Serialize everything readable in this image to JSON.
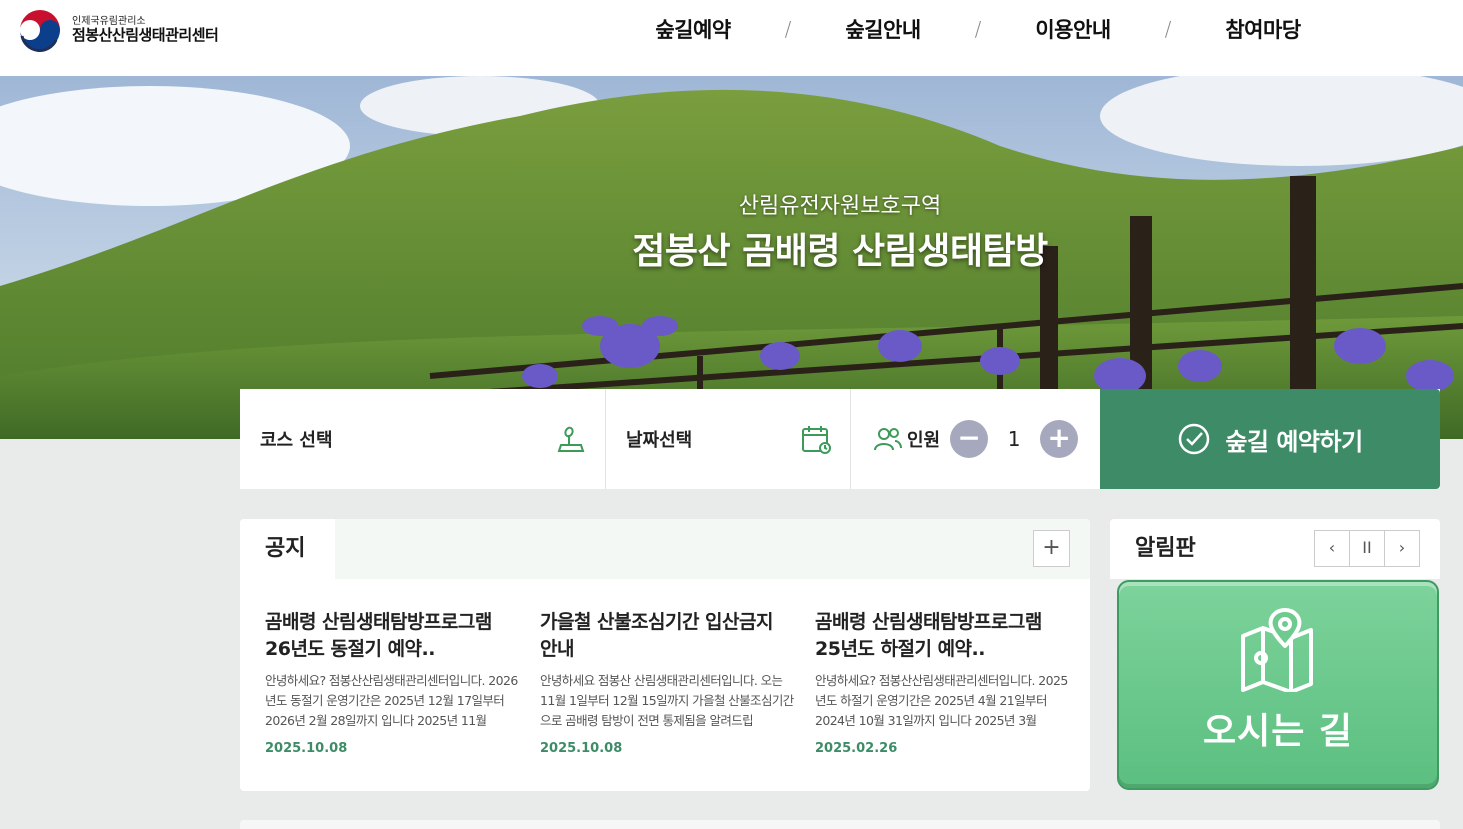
{
  "header": {
    "logo_sub": "인제국유림관리소",
    "logo_main": "점봉산산림생태관리센터",
    "nav": [
      "숲길예약",
      "숲길안내",
      "이용안내",
      "참여마당"
    ],
    "nav_separator": "/"
  },
  "hero": {
    "subtitle": "산림유전자원보호구역",
    "title": "점봉산 곰배령 산림생태탐방"
  },
  "booking": {
    "course_label": "코스 선택",
    "date_label": "날짜선택",
    "people_label": "인원",
    "minus": "−",
    "plus": "+",
    "count": "1",
    "submit_label": "숲길 예약하기"
  },
  "notice": {
    "tab_label": "공지",
    "more": "+",
    "items": [
      {
        "title": "곰배령 산림생태탐방프로그램 26년도 동절기 예약..",
        "body": "안녕하세요? 점봉산산림생태관리센터입니다. 2026년도 동절기 운영기간은 2025년 12월 17일부터 2026년 2월 28일까지 입니다 2025년 11월",
        "date": "2025.10.08"
      },
      {
        "title": "가을철 산불조심기간 입산금지 안내",
        "body": "안녕하세요 점봉산 산림생태관리센터입니다. 오는 11월 1일부터 12월 15일까지 가을철 산불조심기간으로 곰배령 탐방이 전면 통제됨을 알려드립",
        "date": "2025.10.08"
      },
      {
        "title": "곰배령 산림생태탐방프로그램 25년도 하절기 예약..",
        "body": "안녕하세요? 점봉산산림생태관리센터입니다. 2025년도 하절기 운영기간은 2025년 4월 21일부터 2024년 10월 31일까지 입니다 2025년 3월",
        "date": "2025.02.26"
      }
    ]
  },
  "alarm": {
    "title": "알림판",
    "prev": "‹",
    "pause": "II",
    "next": "›",
    "card_label": "오시는 길"
  },
  "colors": {
    "accent": "#3d8c67",
    "round_btn": "#a6a8bd",
    "route_card": "#6fca8f"
  }
}
